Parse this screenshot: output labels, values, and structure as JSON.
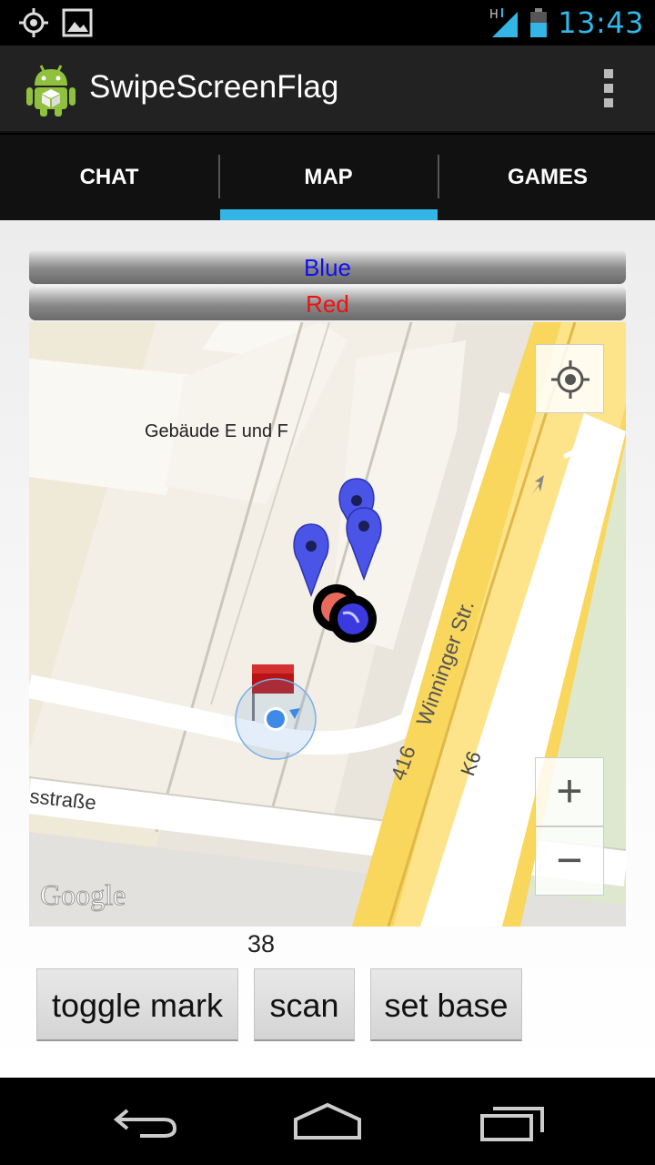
{
  "status_bar": {
    "time": "13:43",
    "network_type": "H",
    "icons": [
      "gps-icon",
      "gallery-icon",
      "signal-icon",
      "battery-icon"
    ]
  },
  "app": {
    "title": "SwipeScreenFlag",
    "icon": "android-icon",
    "menu_icon": "overflow-menu-icon"
  },
  "tabs": [
    {
      "label": "CHAT",
      "selected": false
    },
    {
      "label": "MAP",
      "selected": true
    },
    {
      "label": "GAMES",
      "selected": false
    }
  ],
  "teams": {
    "blue": {
      "label": "Blue",
      "color": "#1010ee"
    },
    "red": {
      "label": "Red",
      "color": "#ee1111"
    }
  },
  "map": {
    "building_label": "Gebäude E und F",
    "street_1": "Winninger Str.",
    "street_2": "sstraße",
    "road_number": "416",
    "road_code": "K6",
    "provider": "Google",
    "zoom_in_label": "+",
    "zoom_out_label": "−",
    "accent_color": "#33b5e5"
  },
  "counter": "38",
  "buttons": {
    "toggle_mark": "toggle mark",
    "scan": "scan",
    "set_base": "set base"
  }
}
